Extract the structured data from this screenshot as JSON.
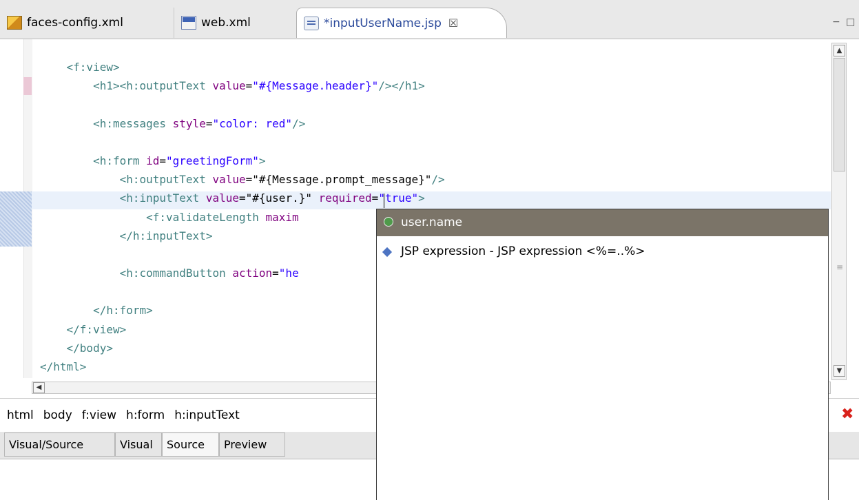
{
  "tabs": [
    {
      "label": "faces-config.xml",
      "icon": "faces-config-icon"
    },
    {
      "label": "web.xml",
      "icon": "web-xml-icon"
    },
    {
      "label": "*inputUserName.jsp",
      "icon": "jsp-file-icon",
      "active": true,
      "close": "☒"
    }
  ],
  "window_controls": "− □",
  "code_lines": [
    [
      {
        "c": "t",
        "s": "    <f:view>"
      }
    ],
    [
      {
        "c": "t",
        "s": "        <h1><h:outputText "
      },
      {
        "c": "a",
        "s": "value"
      },
      {
        "c": "p",
        "s": "="
      },
      {
        "c": "v",
        "s": "\"#{Message.header}\""
      },
      {
        "c": "t",
        "s": "/></h1>"
      }
    ],
    [],
    [
      {
        "c": "t",
        "s": "        <h:messages "
      },
      {
        "c": "a",
        "s": "style"
      },
      {
        "c": "p",
        "s": "="
      },
      {
        "c": "v",
        "s": "\"color: red\""
      },
      {
        "c": "t",
        "s": "/>"
      }
    ],
    [],
    [
      {
        "c": "t",
        "s": "        <h:form "
      },
      {
        "c": "a",
        "s": "id"
      },
      {
        "c": "p",
        "s": "="
      },
      {
        "c": "v",
        "s": "\"greetingForm\""
      },
      {
        "c": "t",
        "s": ">"
      }
    ],
    [
      {
        "c": "t",
        "s": "            <h:outputText "
      },
      {
        "c": "a",
        "s": "value"
      },
      {
        "c": "p",
        "s": "="
      },
      {
        "c": "p",
        "s": "\"#{Message.prompt_message}\""
      },
      {
        "c": "t",
        "s": "/>"
      }
    ],
    [
      {
        "c": "t",
        "s": "            <h:inputText "
      },
      {
        "c": "a",
        "s": "value"
      },
      {
        "c": "p",
        "s": "="
      },
      {
        "c": "p",
        "s": "\"#{user.}\""
      },
      {
        "c": "t",
        "s": " "
      },
      {
        "c": "a",
        "s": "required"
      },
      {
        "c": "p",
        "s": "="
      },
      {
        "c": "v",
        "s": "\"true\""
      },
      {
        "c": "t",
        "s": ">"
      }
    ],
    [
      {
        "c": "t",
        "s": "                <f:validateLength "
      },
      {
        "c": "a",
        "s": "maxim"
      }
    ],
    [
      {
        "c": "t",
        "s": "            </h:inputText>"
      }
    ],
    [],
    [
      {
        "c": "t",
        "s": "            <h:commandButton "
      },
      {
        "c": "a",
        "s": "action"
      },
      {
        "c": "p",
        "s": "="
      },
      {
        "c": "v",
        "s": "\"he"
      }
    ],
    [],
    [
      {
        "c": "t",
        "s": "        </h:form>"
      }
    ],
    [
      {
        "c": "t",
        "s": "    </f:view>"
      }
    ],
    [
      {
        "c": "t",
        "s": "    </body>"
      }
    ],
    [
      {
        "c": "t",
        "s": "</html>"
      }
    ]
  ],
  "breadcrumb": [
    "html",
    "body",
    "f:view",
    "h:form",
    "h:inputText"
  ],
  "error_icon": "✖",
  "bottom_tabs": [
    {
      "label": "Visual/Source"
    },
    {
      "label": "Visual"
    },
    {
      "label": "Source",
      "active": true
    },
    {
      "label": "Preview"
    }
  ],
  "content_assist": {
    "selected": "user.name",
    "items": [
      "JSP expression - JSP expression <%=..%>"
    ]
  },
  "scroll_up": "▲",
  "scroll_down": "▼",
  "scroll_left": "◀",
  "scroll_grip": "≡"
}
